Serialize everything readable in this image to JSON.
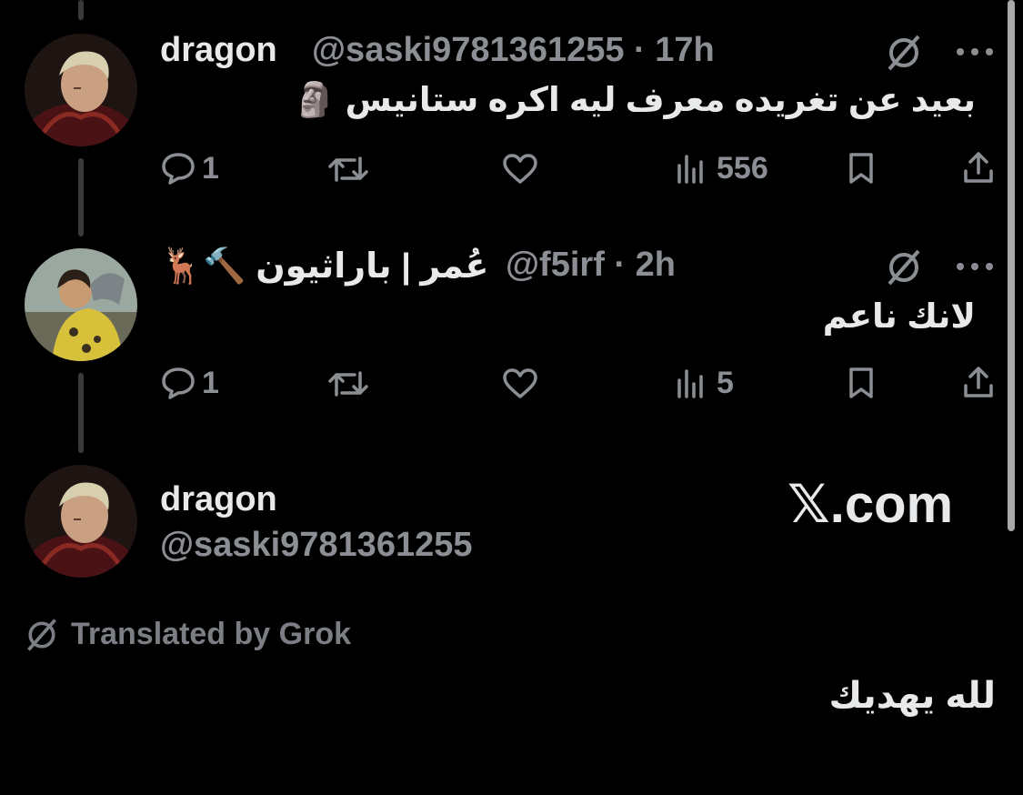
{
  "tweets": [
    {
      "author_name": "dragon",
      "handle_time": "@saski9781361255 · 17h",
      "text": "بعيد عن تغريده معرف ليه اكره ستانيس 🗿",
      "replies": "1",
      "views": "556"
    },
    {
      "author_name": "🦌🔨 عُمر | باراثيون",
      "handle_time": "@f5irf · 2h",
      "text": "لانك ناعم",
      "replies": "1",
      "views": "5"
    }
  ],
  "focused": {
    "author_name": "dragon",
    "handle": "@saski9781361255",
    "watermark": "𝕏.com",
    "translated_by": "Translated by Grok",
    "text": "لله يهديك"
  },
  "icons": {
    "grok": "grok-icon",
    "more": "more-dots-icon",
    "reply": "reply-bubble-icon",
    "retweet": "retweet-icon",
    "like": "heart-icon",
    "views": "views-bar-chart-icon",
    "bookmark": "bookmark-icon",
    "share": "share-icon"
  },
  "colors": {
    "background": "#000000",
    "text": "#e7e9ea",
    "muted": "#8b8f94",
    "thread_line": "#3a3a3a"
  }
}
